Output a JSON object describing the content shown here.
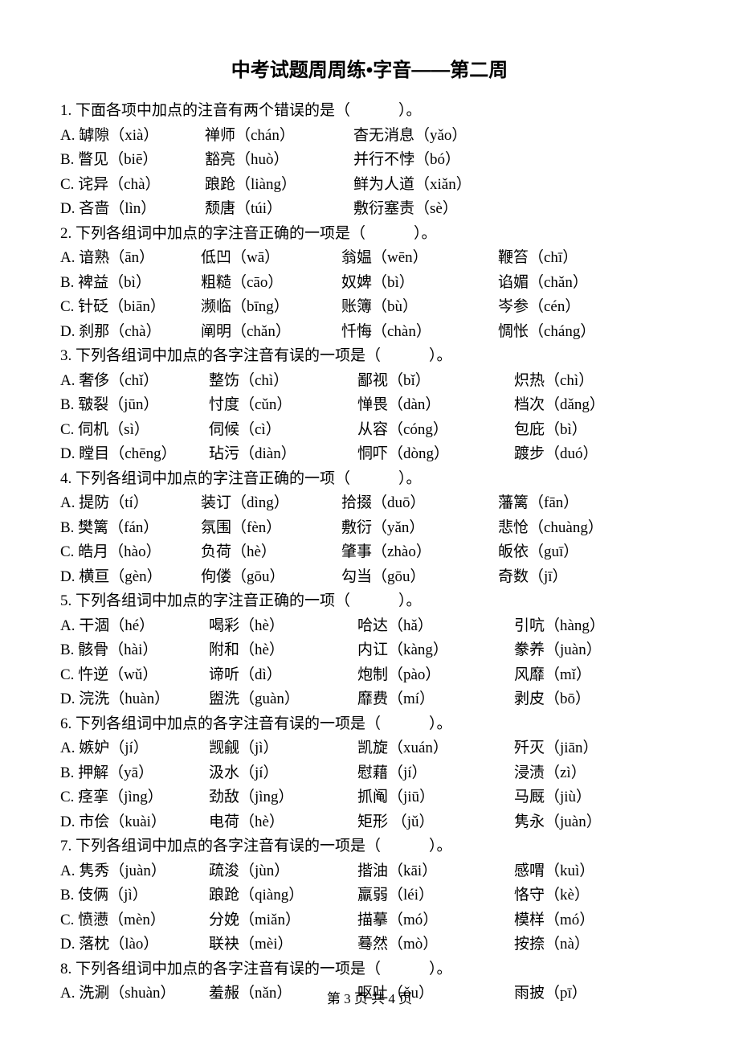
{
  "title": "中考试题周周练•字音——第二周",
  "footer": "第 3 页 共 4 页",
  "q1": {
    "prompt": "1. 下面各项中加点的注音有两个错误的是（",
    "prompt_end": "）。",
    "rows": [
      [
        "A. 罅隙（xià）",
        "禅师（chán）",
        "杳无消息（yǎo）"
      ],
      [
        "B. 瞥见（biē）",
        "豁亮（huò）",
        "并行不悖（bó）"
      ],
      [
        "C. 诧异（chà）",
        "踉跄（liàng）",
        "鲜为人道（xiǎn）"
      ],
      [
        "D. 吝啬（lìn）",
        "颓唐（túi）",
        "敷衍塞责（sè）"
      ]
    ]
  },
  "q2": {
    "prompt": "2. 下列各组词中加点的字注音正确的一项是（",
    "prompt_end": "）。",
    "rows": [
      [
        "A. 谙熟（ān）",
        "低凹（wā）",
        "翁媪（wēn）",
        "鞭笞（chī）"
      ],
      [
        "B. 裨益（bì）",
        "粗糙（cāo）",
        "奴婢（bì）",
        "谄媚（chǎn）"
      ],
      [
        "C. 针砭（biān）",
        "濒临（bīng）",
        "账簿（bù）",
        "岑参（cén）"
      ],
      [
        "D. 刹那（chà）",
        "阐明（chǎn）",
        "忏悔（chàn）",
        "惆怅（cháng）"
      ]
    ]
  },
  "q3": {
    "prompt": "3. 下列各组词中加点的各字注音有误的一项是（",
    "prompt_end": "）。",
    "rows": [
      [
        "A. 奢侈（chǐ）",
        "整饬（chì）",
        "鄙视（bǐ）",
        "炽热（chì）"
      ],
      [
        "B. 皲裂（jūn）",
        "忖度（cǔn）",
        "惮畏（dàn）",
        "档次（dǎng）"
      ],
      [
        "C. 伺机（sì）",
        "伺候（cì）",
        "从容（cóng）",
        "包庇（bì）"
      ],
      [
        "D. 瞠目（chēng）",
        "玷污（diàn）",
        "恫吓（dòng）",
        "踱步（duó）"
      ]
    ]
  },
  "q4": {
    "prompt": "4. 下列各组词中加点的字注音正确的一项（",
    "prompt_end": "）。",
    "rows": [
      [
        "A. 提防（tí）",
        "装订（dìng）",
        "拾掇（duō）",
        "藩篱（fān）"
      ],
      [
        "B. 樊篱（fán）",
        "氛围（fèn）",
        "敷衍（yǎn）",
        "悲怆（chuàng）"
      ],
      [
        "C. 皓月（hào）",
        "负荷（hè）",
        "肇事（zhào）",
        "皈依（guī）"
      ],
      [
        "D. 横亘（gèn）",
        "佝偻（gōu）",
        "勾当（gōu）",
        "奇数（jī）"
      ]
    ]
  },
  "q5": {
    "prompt": "5. 下列各组词中加点的字注音正确的一项（",
    "prompt_end": "）。",
    "rows": [
      [
        "A. 干涸（hé）",
        "喝彩（hè）",
        "哈达（hǎ）",
        "引吭（hàng）"
      ],
      [
        "B. 骸骨（hài）",
        "附和（hè）",
        "内讧（kàng）",
        "豢养（juàn）"
      ],
      [
        "C. 忤逆（wǔ）",
        "谛听（dì）",
        "炮制（pào）",
        "风靡（mǐ）"
      ],
      [
        "D. 浣洗（huàn）",
        "盥洗（guàn）",
        "靡费（mí）",
        "剥皮（bō）"
      ]
    ]
  },
  "q6": {
    "prompt": "6. 下列各组词中加点的各字注音有误的一项是（",
    "prompt_end": "）。",
    "rows": [
      [
        "A. 嫉妒（jí）",
        "觊觎（jì）",
        "凯旋（xuán）",
        "歼灭（jiān）"
      ],
      [
        "B. 押解（yā）",
        "汲水（jí）",
        "慰藉（jí）",
        "浸渍（zì）"
      ],
      [
        "C. 痉挛（jìng）",
        "劲敌（jìng）",
        "抓阄（jiū）",
        "马厩（jiù）"
      ],
      [
        "D. 市侩（kuài）",
        "电荷（hè）",
        "矩形 （jǔ）",
        "隽永（juàn）"
      ]
    ]
  },
  "q7": {
    "prompt": "7. 下列各组词中加点的各字注音有误的一项是（",
    "prompt_end": "）。",
    "rows": [
      [
        "A. 隽秀（juàn）",
        "疏浚（jùn）",
        "揩油（kāi）",
        "感喟（kuì）"
      ],
      [
        "B. 伎俩（jì）",
        "踉跄（qiàng）",
        "羸弱（léi）",
        "恪守（kè）"
      ],
      [
        "C. 愤懑（mèn）",
        "分娩（miǎn）",
        "描摹（mó）",
        "模样（mó）"
      ],
      [
        "D. 落枕（lào）",
        "联袂（mèi）",
        "蓦然（mò）",
        "按捺（nà）"
      ]
    ]
  },
  "q8": {
    "prompt": "8. 下列各组词中加点的各字注音有误的一项是（",
    "prompt_end": "）。",
    "rows": [
      [
        "A. 洗涮（shuàn）",
        "羞赧（nǎn）",
        "呕吐（ǒu）",
        "雨披（pī）"
      ]
    ]
  }
}
